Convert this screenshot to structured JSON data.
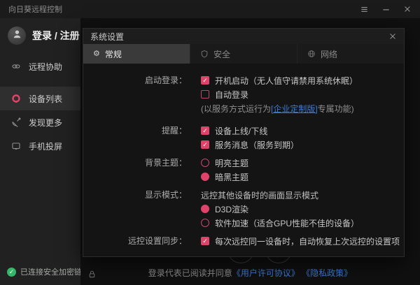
{
  "colors": {
    "accent": "#e0436a",
    "link": "#3c7bd9",
    "green": "#35b56a"
  },
  "titlebar": {
    "title": "向日葵远程控制",
    "controls": [
      {
        "name": "menu",
        "icon": "menu-icon"
      },
      {
        "name": "minimize",
        "icon": "minimize-icon"
      },
      {
        "name": "close",
        "icon": "close-icon"
      }
    ]
  },
  "sidebar": {
    "login_label": "登录 / 注册",
    "items": [
      {
        "label": "远程协助",
        "icon": "handshake-icon",
        "active": false
      },
      {
        "label": "设备列表",
        "icon": "device-list-icon",
        "active": true
      },
      {
        "label": "发现更多",
        "icon": "discover-icon",
        "active": false
      },
      {
        "label": "手机投屏",
        "icon": "phone-cast-icon",
        "active": false
      }
    ],
    "status_label": "已连接安全加密链路"
  },
  "dialog": {
    "title": "系统设置",
    "tabs": [
      {
        "label": "常规",
        "icon": "gear-icon",
        "active": true
      },
      {
        "label": "安全",
        "icon": "shield-icon",
        "active": false
      },
      {
        "label": "网络",
        "icon": "globe-icon",
        "active": false
      }
    ],
    "sections": [
      {
        "label": "启动登录：",
        "rows": [
          {
            "type": "checkbox",
            "checked": true,
            "text": "开机启动（无人值守请禁用系统休眠）"
          },
          {
            "type": "checkbox",
            "checked": false,
            "text": "自动登录"
          },
          {
            "type": "note",
            "prefix": "(以服务方式运行为",
            "link": "[企业定制版]",
            "suffix": "专属功能)"
          }
        ]
      },
      {
        "label": "提醒：",
        "rows": [
          {
            "type": "checkbox",
            "checked": true,
            "text": "设备上线/下线"
          },
          {
            "type": "checkbox",
            "checked": true,
            "text": "服务消息（服务到期）"
          }
        ]
      },
      {
        "label": "背景主题：",
        "rows": [
          {
            "type": "radio",
            "checked": false,
            "text": "明亮主题"
          },
          {
            "type": "radio",
            "checked": true,
            "text": "暗黑主题"
          }
        ]
      },
      {
        "label": "显示模式：",
        "rows": [
          {
            "type": "text",
            "text": "远控其他设备时的画面显示模式"
          },
          {
            "type": "radio",
            "checked": true,
            "text": "D3D渲染"
          },
          {
            "type": "radio",
            "checked": false,
            "text": "软件加速（适合GPU性能不佳的设备）"
          }
        ]
      },
      {
        "label": "远控设置同步：",
        "rows": [
          {
            "type": "checkbox",
            "checked": true,
            "text": "每次远控同一设备时，自动恢复上次远控的设置项"
          }
        ]
      }
    ]
  },
  "footer": {
    "agreement_prefix": "登录代表已阅读并同意",
    "links": [
      "《用户许可协议》",
      "《隐私政策》"
    ]
  }
}
